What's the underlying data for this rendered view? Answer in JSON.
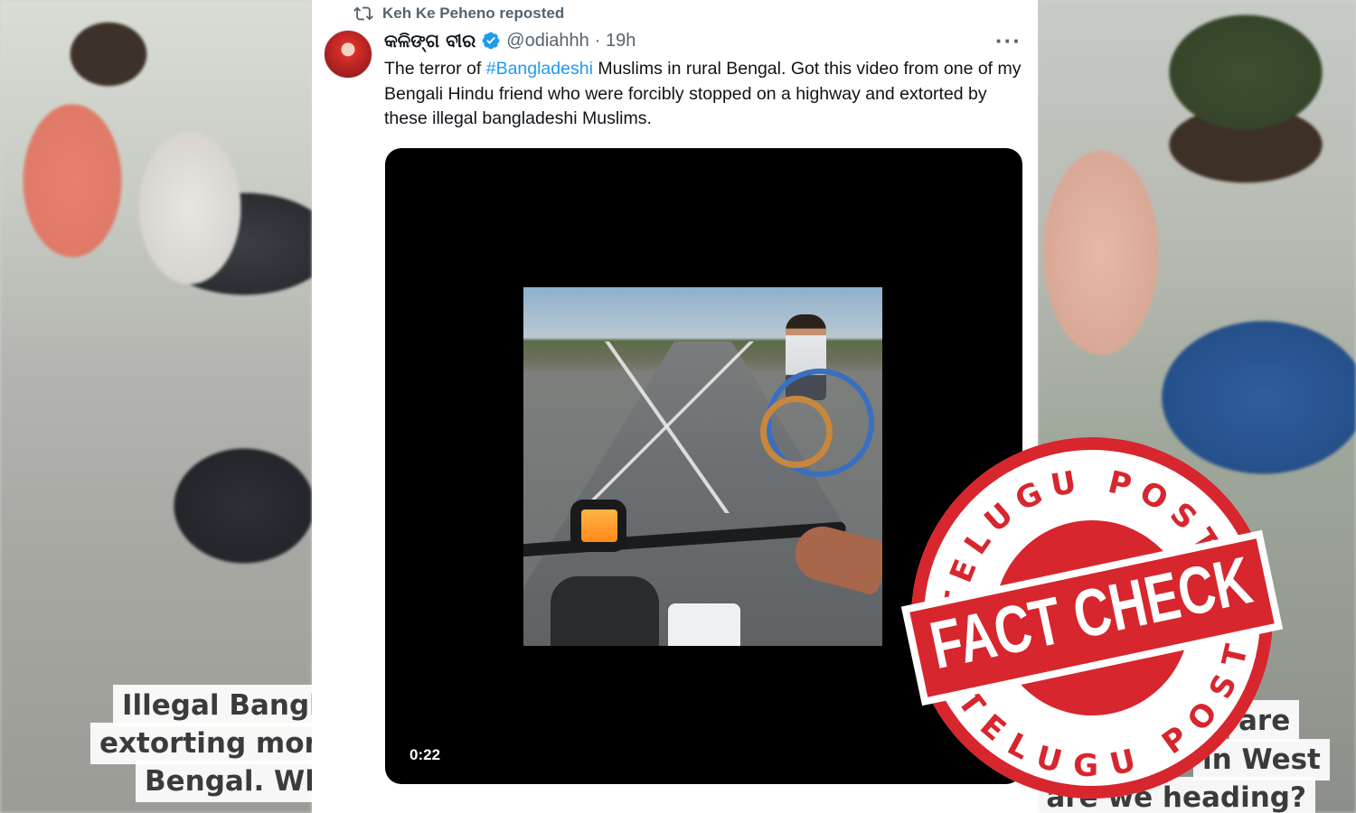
{
  "tweet": {
    "repost_label": "Keh Ke Peheno reposted",
    "author_name": "କଳିଙ୍ଗ ବୀର",
    "handle": "@odiahhh",
    "time": "· 19h",
    "more": "···",
    "text_before": "The terror of ",
    "hashtag": "#Bangladeshi",
    "text_after": " Muslims in rural Bengal. Got this video from one of my Bengali Hindu friend who were forcibly stopped on a highway and extorted by these illegal bangladeshi Muslims.",
    "video_duration": "0:22"
  },
  "background_captions": {
    "left": [
      "Illegal Bangla",
      "extorting mon",
      "Bengal. Wh"
    ],
    "right": [
      "are",
      "in West",
      "Bengal. Where are we heading?"
    ]
  },
  "stamp": {
    "top_text": "TELUGU POST",
    "main_text": "FACT CHECK",
    "bottom_text": "TELUGU POST",
    "color": "#d7262d"
  },
  "colors": {
    "link": "#1d9bf0",
    "verified": "#1d9bf0",
    "muted": "#536471"
  },
  "icons": {
    "repost": "repost-icon",
    "verified": "verified-badge-icon",
    "more": "more-options-icon"
  }
}
